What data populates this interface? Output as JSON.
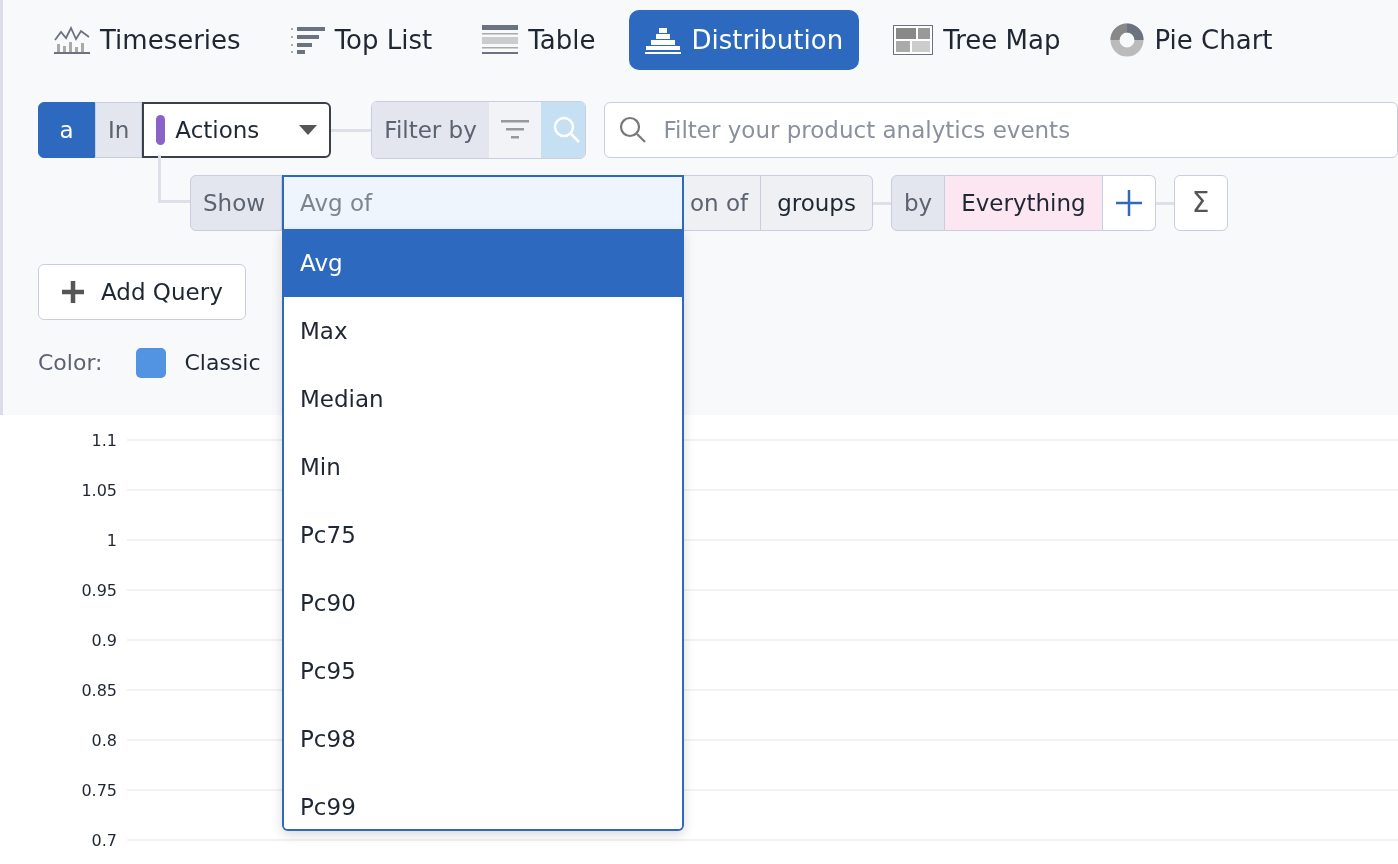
{
  "tabs": [
    {
      "label": "Timeseries",
      "kind": "timeseries",
      "selected": false
    },
    {
      "label": "Top List",
      "kind": "toplist",
      "selected": false
    },
    {
      "label": "Table",
      "kind": "table",
      "selected": false
    },
    {
      "label": "Distribution",
      "kind": "distribution",
      "selected": true
    },
    {
      "label": "Tree Map",
      "kind": "treemap",
      "selected": false
    },
    {
      "label": "Pie Chart",
      "kind": "pie",
      "selected": false
    }
  ],
  "query": {
    "letter": "a",
    "source_label": "In",
    "source": "Actions",
    "filter_label": "Filter by",
    "search": {
      "placeholder": "Filter your product analytics events"
    }
  },
  "measure": {
    "show_label": "Show",
    "input": {
      "placeholder": "Avg of"
    },
    "suffix": "on of",
    "target": "groups",
    "by_label": "by",
    "group_by": "Everything",
    "sum": "Σ"
  },
  "dropdown": {
    "options": [
      {
        "label": "Avg",
        "selected": true
      },
      {
        "label": "Max",
        "selected": false
      },
      {
        "label": "Median",
        "selected": false
      },
      {
        "label": "Min",
        "selected": false
      },
      {
        "label": "Pc75",
        "selected": false
      },
      {
        "label": "Pc90",
        "selected": false
      },
      {
        "label": "Pc95",
        "selected": false
      },
      {
        "label": "Pc98",
        "selected": false
      },
      {
        "label": "Pc99",
        "selected": false
      }
    ]
  },
  "add_query": "Add Query",
  "color": {
    "label": "Color:",
    "palette": "Classic"
  },
  "chart": {
    "y_axis_labels": [
      "1.1",
      "1.05",
      "1",
      "0.95",
      "0.9",
      "0.85",
      "0.8",
      "0.75",
      "0.7"
    ]
  }
}
